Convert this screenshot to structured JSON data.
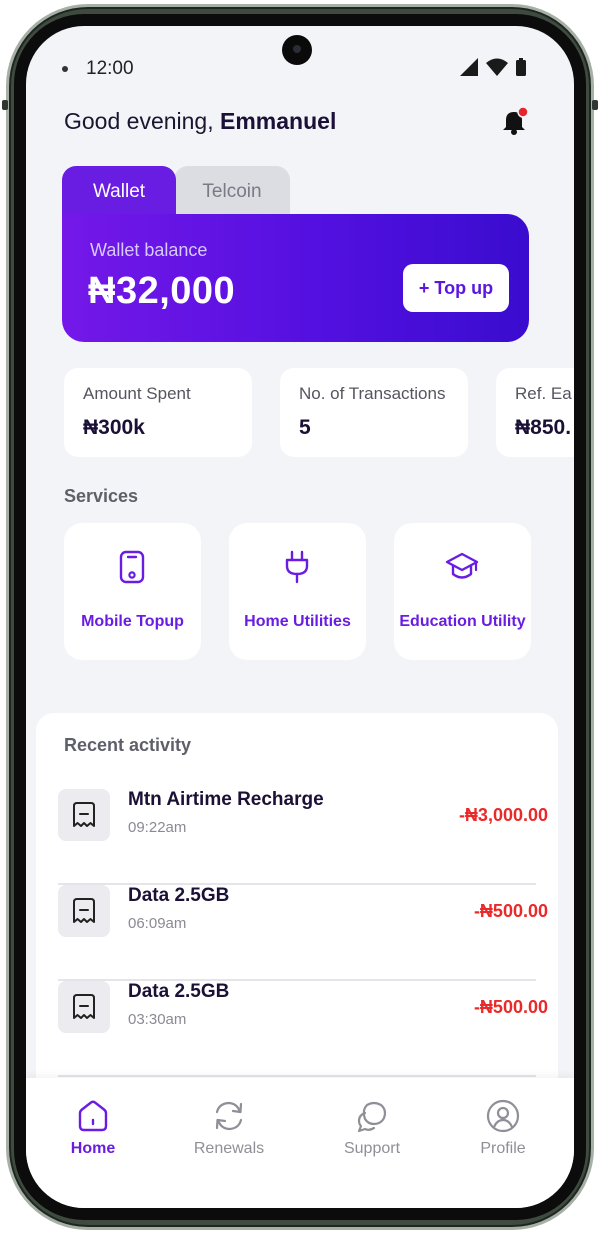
{
  "status_bar": {
    "time": "12:00"
  },
  "header": {
    "greeting_prefix": "Good evening,",
    "user_name": "Emmanuel"
  },
  "wallet": {
    "tabs": [
      "Wallet",
      "Telcoin"
    ],
    "balance_label": "Wallet balance",
    "balance_value": "₦32,000",
    "topup_label": "+ Top up"
  },
  "stats": [
    {
      "label": "Amount Spent",
      "value": "₦300k"
    },
    {
      "label": "No. of Transactions",
      "value": "5"
    },
    {
      "label": "Ref. Ea",
      "value": "₦850."
    }
  ],
  "services": {
    "title": "Services",
    "items": [
      {
        "label": "Mobile Topup",
        "icon": "phone-icon"
      },
      {
        "label": "Home Utilities",
        "icon": "plug-icon"
      },
      {
        "label": "Education Utility",
        "icon": "graduation-cap-icon"
      }
    ]
  },
  "activity": {
    "title": "Recent activity",
    "items": [
      {
        "name": "Mtn Airtime Recharge",
        "time": "09:22am",
        "amount": "-₦3,000.00"
      },
      {
        "name": "Data 2.5GB",
        "time": "06:09am",
        "amount": "-₦500.00"
      },
      {
        "name": "Data 2.5GB",
        "time": "03:30am",
        "amount": "-₦500.00"
      }
    ]
  },
  "nav": {
    "items": [
      {
        "label": "Home",
        "icon": "home-icon",
        "active": true
      },
      {
        "label": "Renewals",
        "icon": "refresh-icon"
      },
      {
        "label": "Support",
        "icon": "chat-icon"
      },
      {
        "label": "Profile",
        "icon": "user-icon"
      }
    ]
  },
  "colors": {
    "accent": "#6a1de2",
    "negative": "#ea2a2a",
    "background": "#f2f4f8"
  }
}
